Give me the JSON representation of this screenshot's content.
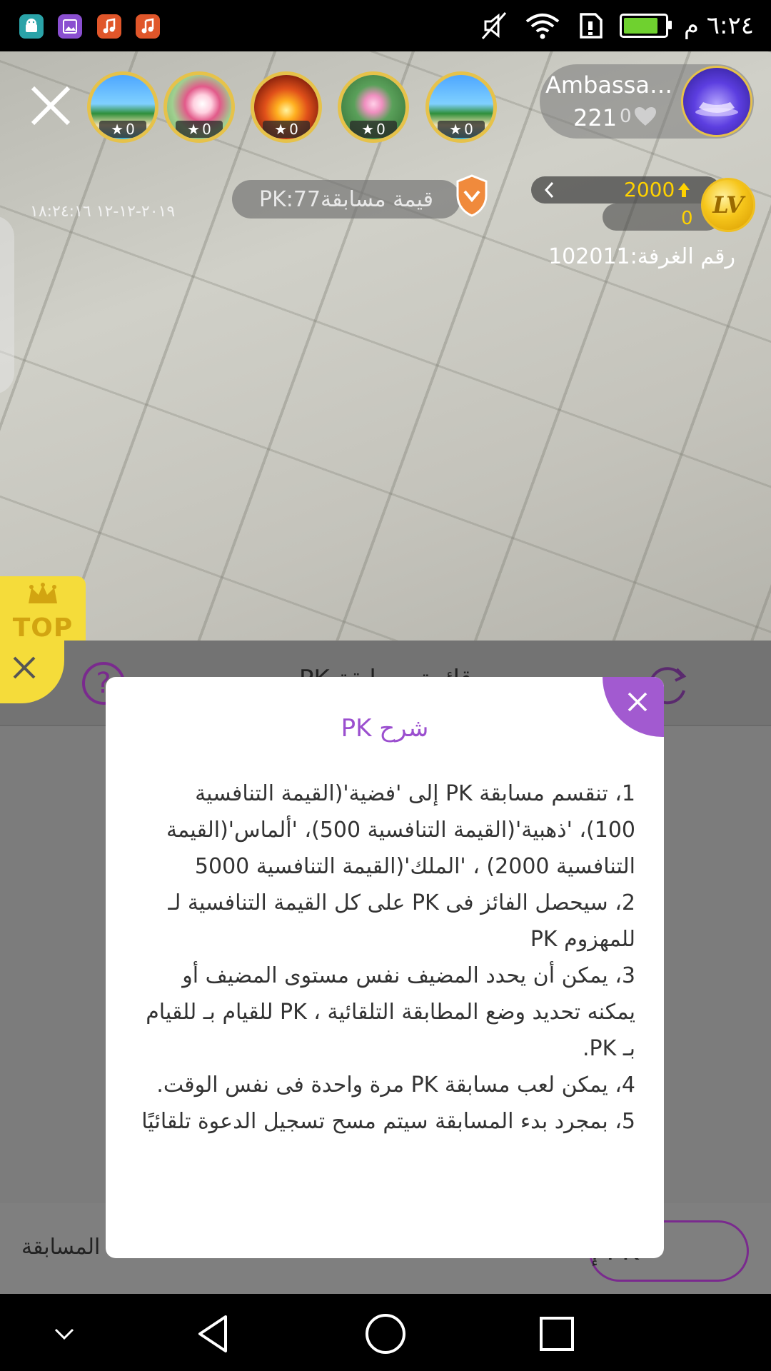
{
  "status_bar": {
    "time": "٦:٢٤ م",
    "battery_percent": 85,
    "app_icons": [
      "android-icon",
      "gallery-icon",
      "music-icon",
      "music-icon"
    ]
  },
  "room": {
    "host_name": "Ambassad...",
    "host_count": "221",
    "host_likes": "0",
    "viewer_badge_counts": [
      "0",
      "0",
      "0",
      "0",
      "0"
    ],
    "pk_value_label": "قيمة مسابقةPK:77",
    "timestamp": "٢٠١٩-١٢-١٢ ١٨:٢٤:١٦",
    "level_points": "2000",
    "level_sub": "0",
    "level_badge": "LV",
    "room_number": "رقم الغرفة:102011",
    "top_badge": "TOP"
  },
  "sheet": {
    "title": "قائمة مسابقة PK",
    "footer_label": "المسابقة",
    "footer_button": "PK إ"
  },
  "modal": {
    "title": "شرح PK",
    "rules": [
      "1، تنقسم مسابقة PK إلى 'فضية'(القيمة التنافسية 100)، 'ذهبية'(القيمة التنافسية 500)، 'ألماس'(القيمة التنافسية 2000) ، 'الملك'(القيمة التنافسية 5000",
      "2، سيحصل الفائز فى PK على كل القيمة التنافسية لـ للمهزوم PK",
      "3، يمكن أن يحدد المضيف نفس مستوى المضيف أو يمكنه تحديد وضع المطابقة التلقائية ، PK للقيام بـ للقيام بـ PK.",
      "4، يمكن لعب مسابقة PK مرة واحدة فى نفس الوقت.",
      "5، بمجرد بدء المسابقة سيتم مسح تسجيل الدعوة تلقائيًا"
    ]
  },
  "colors": {
    "accent_purple": "#9b4fcf",
    "close_purple": "#a25ad0",
    "gold": "#ffd200",
    "top_yellow": "#f5dc3a"
  }
}
